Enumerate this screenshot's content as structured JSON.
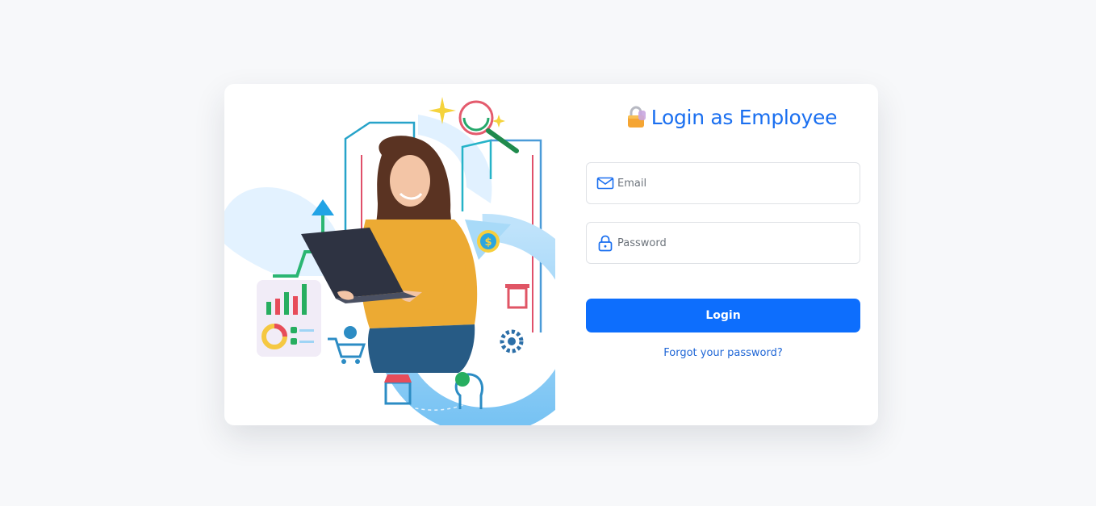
{
  "login": {
    "title": "Login as Employee",
    "email_placeholder": "Email",
    "password_placeholder": "Password",
    "submit_label": "Login",
    "forgot_link": "Forgot your password?"
  },
  "icons": {
    "title": "lock-emoji-icon",
    "email": "envelope-icon",
    "password": "lock-icon"
  },
  "colors": {
    "accent": "#0d6efd",
    "title": "#1a6ff0",
    "link": "#1f66d6",
    "background": "#f7f8fa"
  }
}
